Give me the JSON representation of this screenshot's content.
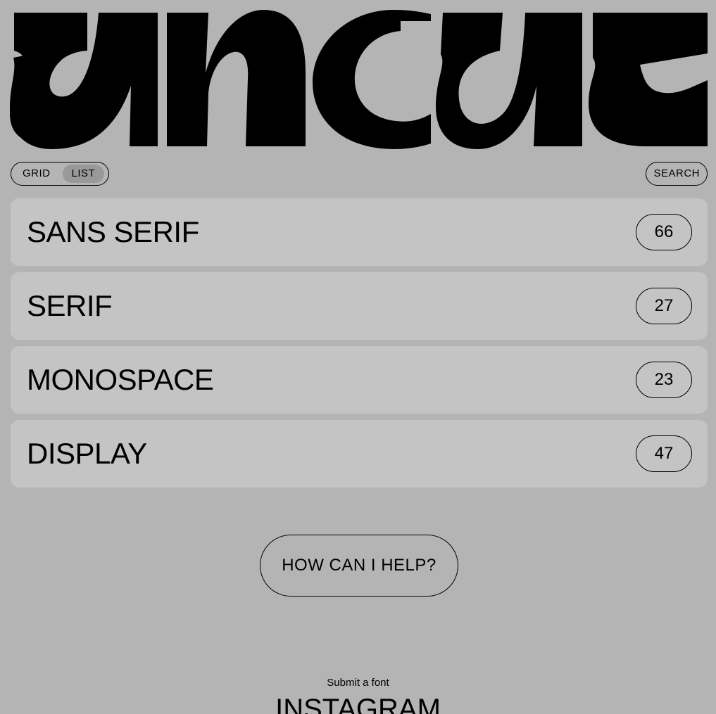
{
  "logo": {
    "name": "uncut",
    "color": "#000000"
  },
  "view_toggle": {
    "grid_label": "GRID",
    "list_label": "LIST",
    "active": "LIST"
  },
  "search": {
    "label": "SEARCH"
  },
  "categories": [
    {
      "label": "SANS SERIF",
      "count": "66"
    },
    {
      "label": "SERIF",
      "count": "27"
    },
    {
      "label": "MONOSPACE",
      "count": "23"
    },
    {
      "label": "DISPLAY",
      "count": "47"
    }
  ],
  "help": {
    "label": "HOW CAN I HELP?"
  },
  "footer": {
    "submit_label": "Submit a font",
    "instagram_label": "INSTAGRAM"
  },
  "colors": {
    "background": "#b4b4b4",
    "row_background": "#c4c4c4",
    "toggle_active": "#999999",
    "text": "#000000"
  }
}
